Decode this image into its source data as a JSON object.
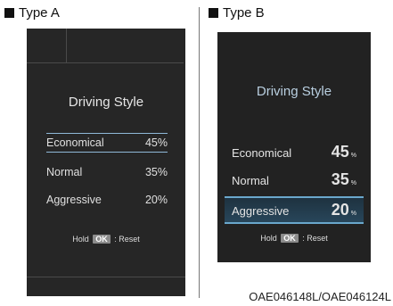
{
  "caption_a": "Type A",
  "caption_b": "Type B",
  "type_a": {
    "title": "Driving Style",
    "rows": [
      {
        "label": "Economical",
        "value": "45%"
      },
      {
        "label": "Normal",
        "value": "35%"
      },
      {
        "label": "Aggressive",
        "value": "20%"
      }
    ],
    "hold_prefix": "Hold",
    "ok_label": "OK",
    "hold_suffix": ": Reset"
  },
  "type_b": {
    "title": "Driving Style",
    "rows": [
      {
        "label": "Economical",
        "value": "45",
        "unit": "%"
      },
      {
        "label": "Normal",
        "value": "35",
        "unit": "%"
      },
      {
        "label": "Aggressive",
        "value": "20",
        "unit": "%"
      }
    ],
    "hold_prefix": "Hold",
    "ok_label": "OK",
    "hold_suffix": ": Reset"
  },
  "footer_code": "OAE046148L/OAE046124L"
}
